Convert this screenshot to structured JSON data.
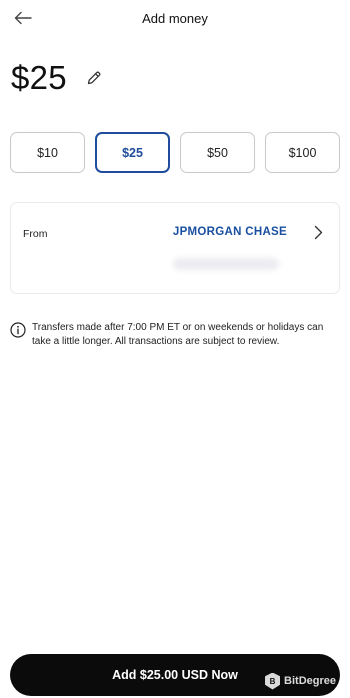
{
  "header": {
    "title": "Add money"
  },
  "amount": {
    "value": "$25"
  },
  "presets": [
    {
      "label": "$10",
      "selected": false
    },
    {
      "label": "$25",
      "selected": true
    },
    {
      "label": "$50",
      "selected": false
    },
    {
      "label": "$100",
      "selected": false
    }
  ],
  "funding_source": {
    "label": "From",
    "bank": "JPMORGAN CHASE"
  },
  "notice": {
    "text": "Transfers made after 7:00 PM ET or on weekends or holidays can take a little longer. All transactions are subject to review."
  },
  "cta": {
    "label": "Add $25.00 USD Now"
  },
  "watermark": {
    "text": "BitDegree",
    "badge": "B"
  },
  "colors": {
    "accent": "#1f4c9c",
    "bank": "#1a4fa0",
    "cta_bg": "#0b0b0b"
  },
  "icons": {
    "back": "arrow-left-icon",
    "edit": "pencil-icon",
    "chevron": "chevron-right-icon",
    "info": "info-icon"
  }
}
